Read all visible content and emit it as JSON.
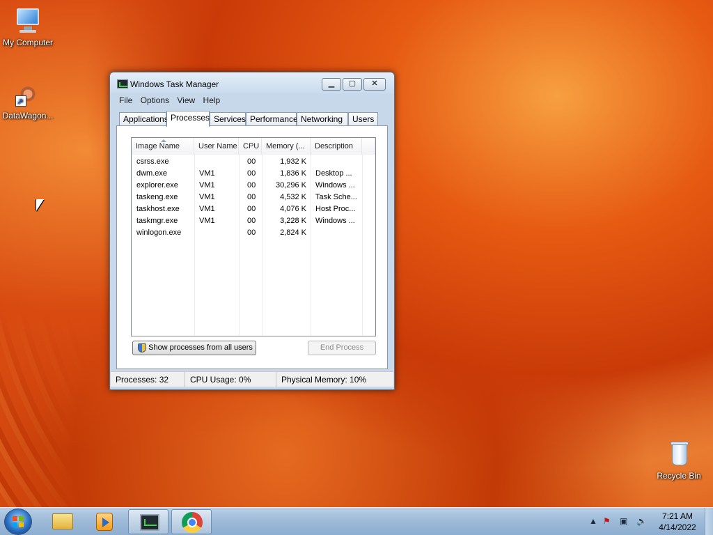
{
  "desktop": {
    "icons": [
      {
        "label": "My Computer"
      },
      {
        "label": "DataWagon..."
      },
      {
        "label": "Recycle Bin"
      }
    ]
  },
  "window": {
    "title": "Windows Task Manager",
    "controls": {
      "minimize": "▁",
      "maximize": "▢",
      "close": "✕"
    },
    "menu": [
      "File",
      "Options",
      "View",
      "Help"
    ],
    "tabs": [
      "Applications",
      "Processes",
      "Services",
      "Performance",
      "Networking",
      "Users"
    ],
    "active_tab": "Processes",
    "columns": [
      "Image Name",
      "User Name",
      "CPU",
      "Memory (...",
      "Description"
    ],
    "processes": [
      {
        "name": "csrss.exe",
        "user": "",
        "cpu": "00",
        "memory": "1,932 K",
        "description": ""
      },
      {
        "name": "dwm.exe",
        "user": "VM1",
        "cpu": "00",
        "memory": "1,836 K",
        "description": "Desktop ..."
      },
      {
        "name": "explorer.exe",
        "user": "VM1",
        "cpu": "00",
        "memory": "30,296 K",
        "description": "Windows ..."
      },
      {
        "name": "taskeng.exe",
        "user": "VM1",
        "cpu": "00",
        "memory": "4,532 K",
        "description": "Task Sche..."
      },
      {
        "name": "taskhost.exe",
        "user": "VM1",
        "cpu": "00",
        "memory": "4,076 K",
        "description": "Host Proc..."
      },
      {
        "name": "taskmgr.exe",
        "user": "VM1",
        "cpu": "00",
        "memory": "3,228 K",
        "description": "Windows ..."
      },
      {
        "name": "winlogon.exe",
        "user": "",
        "cpu": "00",
        "memory": "2,824 K",
        "description": ""
      }
    ],
    "buttons": {
      "show_all": "Show processes from all users",
      "end_process": "End Process"
    },
    "status": {
      "processes": "Processes: 32",
      "cpu": "CPU Usage: 0%",
      "memory": "Physical Memory: 10%"
    }
  },
  "taskbar": {
    "clock_time": "7:21 AM",
    "clock_date": "4/14/2022",
    "tray_icons": [
      "chevron-up-icon",
      "action-center-icon",
      "network-icon",
      "volume-icon"
    ]
  }
}
